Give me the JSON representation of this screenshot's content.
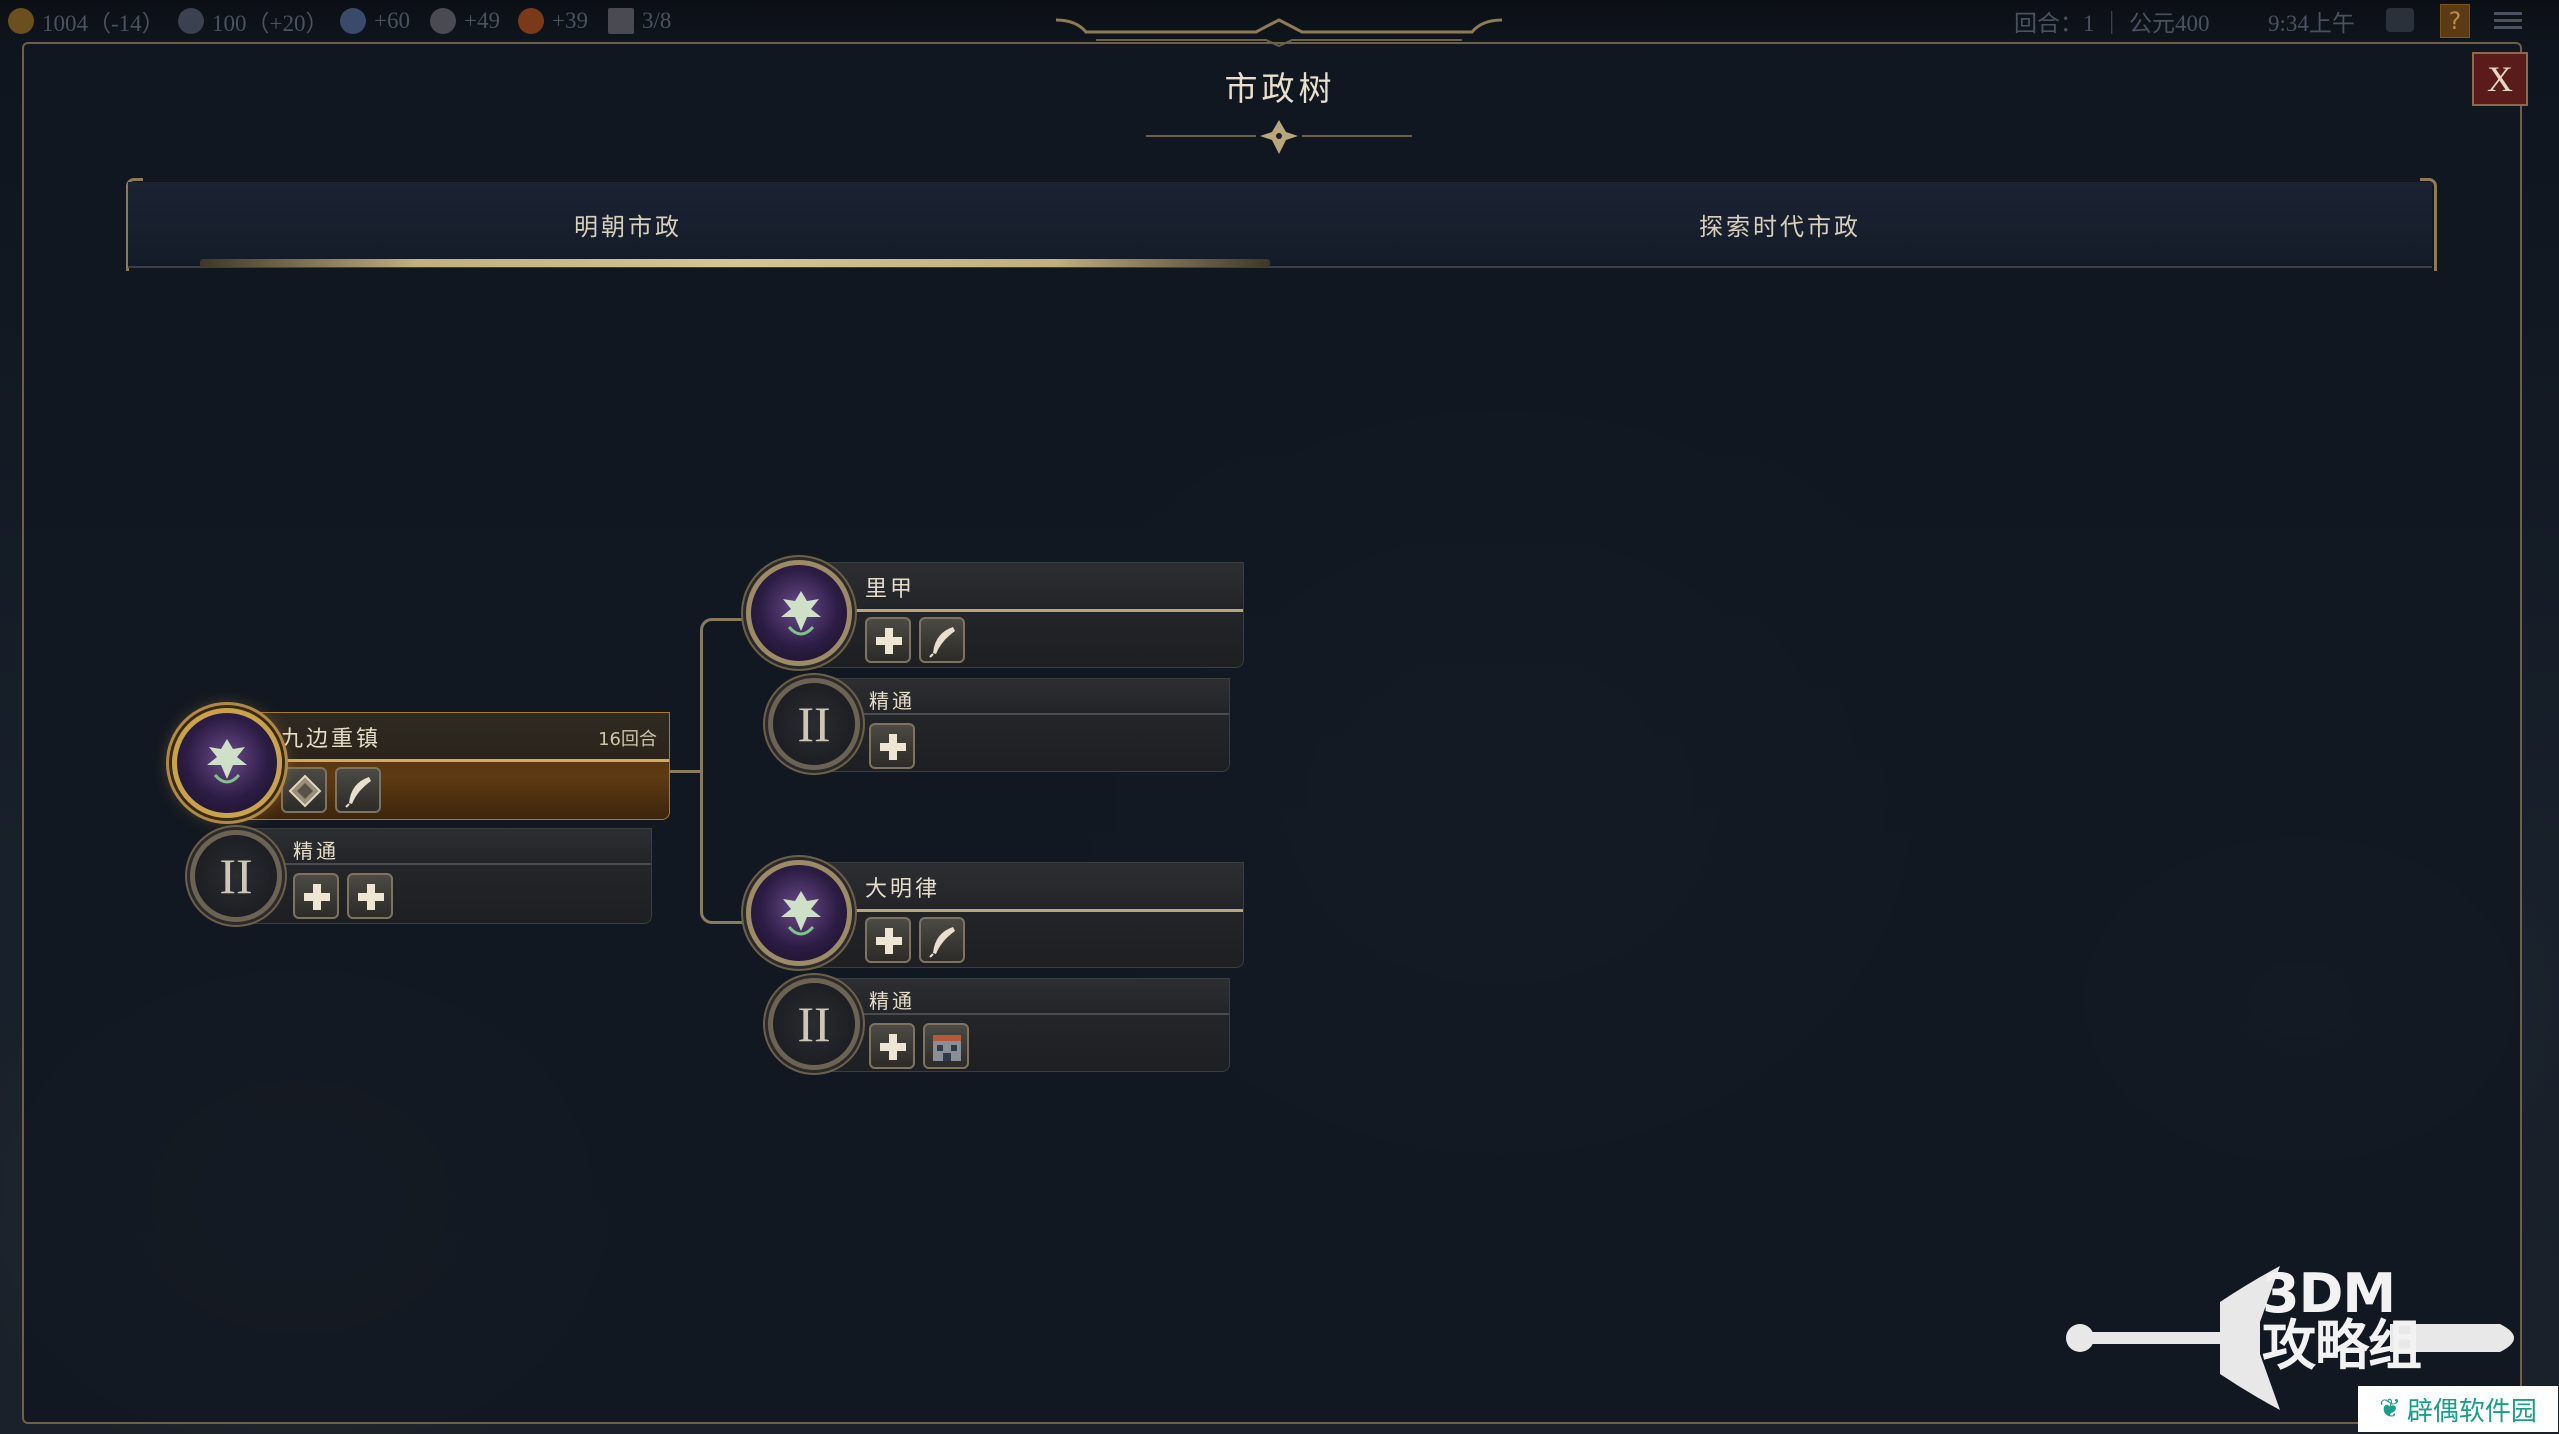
{
  "topbar": {
    "resources": [
      {
        "icon": "gold-icon",
        "text": "1004（-14）",
        "color": "#6b4f1f"
      },
      {
        "icon": "science-globe-icon",
        "text": "100（+20）",
        "color": "#3a4250"
      },
      {
        "icon": "faith-flask-icon",
        "text": "+60",
        "color": "#3a4a6a"
      },
      {
        "icon": "culture-music-icon",
        "text": "+49",
        "color": "#4a4a52"
      },
      {
        "icon": "happiness-face-icon",
        "text": "+39",
        "color": "#7a3a1a"
      },
      {
        "icon": "settlement-icon",
        "text": "3/8",
        "color": "#4a4a52"
      }
    ],
    "turn_label": "回合：1 ｜ 公元400",
    "time": "9:34上午",
    "help_glyph": "?"
  },
  "window": {
    "title": "市政树",
    "close_label": "X"
  },
  "tabs": [
    {
      "label": "明朝市政",
      "active": true
    },
    {
      "label": "探索时代市政",
      "active": false
    }
  ],
  "tree": {
    "nodes": [
      {
        "id": "n1",
        "name": "九边重镇",
        "turns": "16回合",
        "active": true,
        "icons": [
          "wonder-diamond-icon",
          "quill-icon"
        ]
      },
      {
        "id": "n1m",
        "name": "精通",
        "roman": "II",
        "icons": [
          "plus-icon",
          "plus-icon"
        ]
      },
      {
        "id": "n2",
        "name": "里甲",
        "icons": [
          "plus-icon",
          "quill-icon"
        ]
      },
      {
        "id": "n2m",
        "name": "精通",
        "roman": "II",
        "icons": [
          "plus-icon"
        ]
      },
      {
        "id": "n3",
        "name": "大明律",
        "icons": [
          "plus-icon",
          "quill-icon"
        ]
      },
      {
        "id": "n3m",
        "name": "精通",
        "roman": "II",
        "icons": [
          "plus-icon",
          "building-icon"
        ]
      }
    ]
  },
  "watermark": {
    "brand_line1": "3DM",
    "brand_line2": "攻略组",
    "site": "辟偶软件园"
  }
}
